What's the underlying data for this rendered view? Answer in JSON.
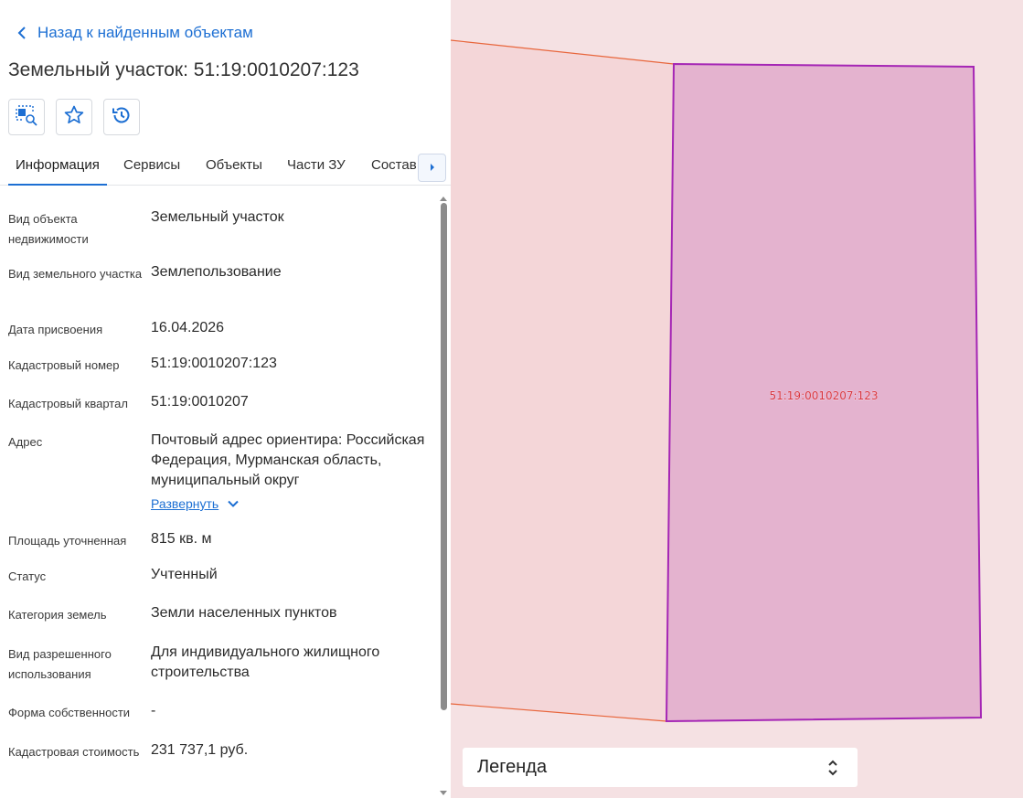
{
  "nav": {
    "back_label": "Назад к найденным объектам"
  },
  "object": {
    "title": "Земельный участок: 51:19:0010207:123"
  },
  "toolbar": {
    "icons": [
      "locate-area-icon",
      "star-icon",
      "history-icon"
    ]
  },
  "tabs": [
    {
      "label": "Информация",
      "active": true
    },
    {
      "label": "Сервисы",
      "active": false
    },
    {
      "label": "Объекты",
      "active": false
    },
    {
      "label": "Части ЗУ",
      "active": false
    },
    {
      "label": "Состав",
      "active": false
    }
  ],
  "info": {
    "rows": [
      {
        "label": "Вид объекта недвижимости",
        "value": "Земельный участок"
      },
      {
        "label": "Вид земельного участка",
        "value": "Землепользование"
      },
      {
        "label": "Дата присвоения",
        "value": "16.04.2026"
      },
      {
        "label": "Кадастровый номер",
        "value": "51:19:0010207:123"
      },
      {
        "label": "Кадастровый квартал",
        "value": "51:19:0010207"
      },
      {
        "label": "Адрес",
        "value": "Почтовый адрес ориентира: Российская Федерация, Мурманская область, муниципальный округ"
      },
      {
        "label": "Площадь уточненная",
        "value": "815 кв. м"
      },
      {
        "label": "Статус",
        "value": "Учтенный"
      },
      {
        "label": "Категория земель",
        "value": "Земли населенных пунктов"
      },
      {
        "label": "Вид разрешенного использования",
        "value": "Для индивидуального жилищного строительства"
      },
      {
        "label": "Форма собственности",
        "value": "-"
      },
      {
        "label": "Кадастровая стоимость",
        "value": "231 737,1 руб."
      }
    ],
    "expand_label": "Развернуть"
  },
  "map": {
    "parcel_label": "51:19:0010207:123",
    "legend_label": "Легенда",
    "colors": {
      "background": "#f5e1e3",
      "neighbor_fill": "#f4d6d8",
      "neighbor_line": "#e8663c",
      "parcel_fill": "#e4b3cf",
      "parcel_stroke": "#a526b5",
      "parcel_text": "#d8323c"
    }
  }
}
